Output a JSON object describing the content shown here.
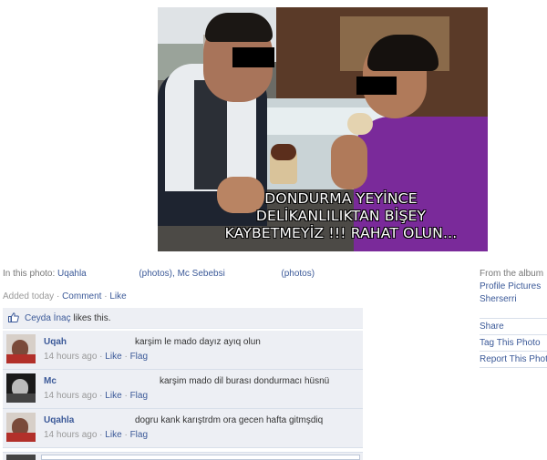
{
  "photo": {
    "caption": "DONDURMA YEYİNCE\nDELİKANLILIKTAN BİŞEY\nKAYBETMEYİZ !!! RAHAT OLUN..."
  },
  "in_this_photo": {
    "label": "In this photo:",
    "tag1": "Uqahla",
    "tag1_suffix": "(photos)",
    "separator": ",",
    "tag2": "Mc Sebebsi",
    "tag2_suffix": "(photos)"
  },
  "added": {
    "time": "Added today",
    "dot": "·",
    "comment": "Comment",
    "like": "Like"
  },
  "likes": {
    "name": "Ceyda İnaç",
    "text": "likes this."
  },
  "comments": [
    {
      "name": "Uqah",
      "text": "karşim le mado dayız ayıq olun",
      "time": "14 hours ago",
      "like": "Like",
      "flag": "Flag",
      "dot": "·"
    },
    {
      "name": "Mc",
      "text": "karşim mado dil burası dondurmacı hüsnü",
      "time": "14 hours ago",
      "like": "Like",
      "flag": "Flag",
      "dot": "·"
    },
    {
      "name": "Uqahla",
      "text": "dogru kank karıştrdm ora gecen hafta gitmşdiq",
      "time": "14 hours ago",
      "like": "Like",
      "flag": "Flag",
      "dot": "·"
    }
  ],
  "sidebar": {
    "from_album": "From the album",
    "album": "Profile Pictures",
    "owner": "Sherserri",
    "actions": [
      "Share",
      "Tag This Photo",
      "Report This Photo"
    ]
  },
  "colors": {
    "link": "#3b5998",
    "panel": "#edeff4"
  }
}
